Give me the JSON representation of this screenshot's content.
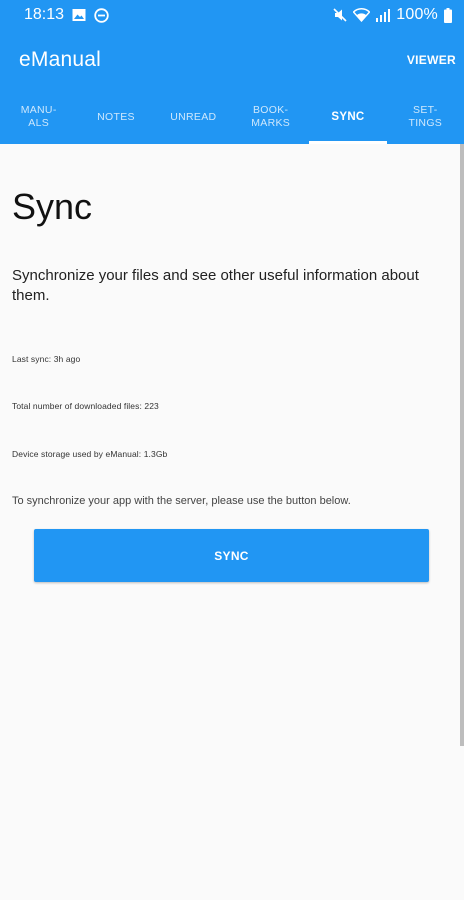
{
  "status_bar": {
    "time": "18:13",
    "battery_percent": "100%",
    "icons": [
      "image-icon",
      "minus-circle-icon",
      "mute-icon",
      "wifi-icon",
      "signal-icon",
      "battery-icon"
    ]
  },
  "app_bar": {
    "title": "eManual",
    "action_label": "VIEWER"
  },
  "tabs": [
    {
      "label": "MANU-\nALS",
      "active": false
    },
    {
      "label": "NOTES",
      "active": false
    },
    {
      "label": "UNREAD",
      "active": false
    },
    {
      "label": "BOOK-\nMARKS",
      "active": false
    },
    {
      "label": "SYNC",
      "active": true
    },
    {
      "label": "SET-\nTINGS",
      "active": false
    }
  ],
  "main": {
    "title": "Sync",
    "intro": "Synchronize your files and see other useful information about them.",
    "last_sync": "Last sync: 3h ago",
    "total_files": "Total number of downloaded files: 223",
    "storage": "Device storage used by eManual: 1.3Gb",
    "instructions": "To synchronize your app with the server, please use the button below.",
    "button_label": "SYNC"
  },
  "colors": {
    "primary": "#2196f3",
    "background": "#fafafa",
    "text": "#111111"
  }
}
